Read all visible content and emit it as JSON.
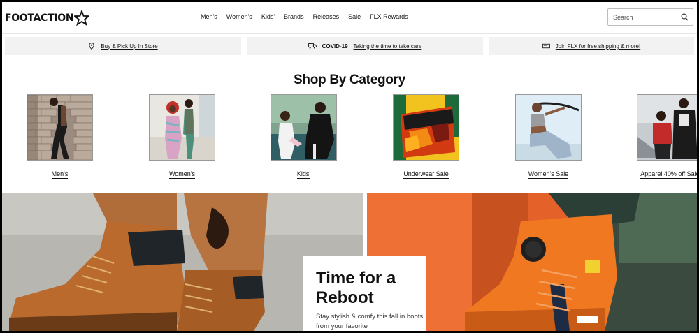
{
  "brand": {
    "name": "FOOTACTION"
  },
  "nav": {
    "items": [
      "Men's",
      "Women's",
      "Kids'",
      "Brands",
      "Releases",
      "Sale",
      "FLX Rewards"
    ]
  },
  "search": {
    "placeholder": "Search"
  },
  "promos": [
    {
      "icon": "location-pin-icon",
      "label": "Buy & Pick Up In Store"
    },
    {
      "icon": "truck-icon",
      "prefix": "COVID-19",
      "label": "Taking the time to take care"
    },
    {
      "icon": "flx-card-icon",
      "label": "Join FLX for free shipping & more!"
    }
  ],
  "category": {
    "title": "Shop By Category",
    "items": [
      {
        "label": "Men's"
      },
      {
        "label": "Women's"
      },
      {
        "label": "Kids'"
      },
      {
        "label": "Underwear Sale"
      },
      {
        "label": "Women's Sale"
      },
      {
        "label": "Apparel 40% off Sale"
      }
    ]
  },
  "hero": {
    "title": "Time for a Reboot",
    "body": "Stay stylish & comfy this fall in boots from your favorite"
  },
  "colors": {
    "boot_wheat": "#b96a2c",
    "boot_orange": "#e8672a",
    "page_bg": "#ffffff"
  }
}
